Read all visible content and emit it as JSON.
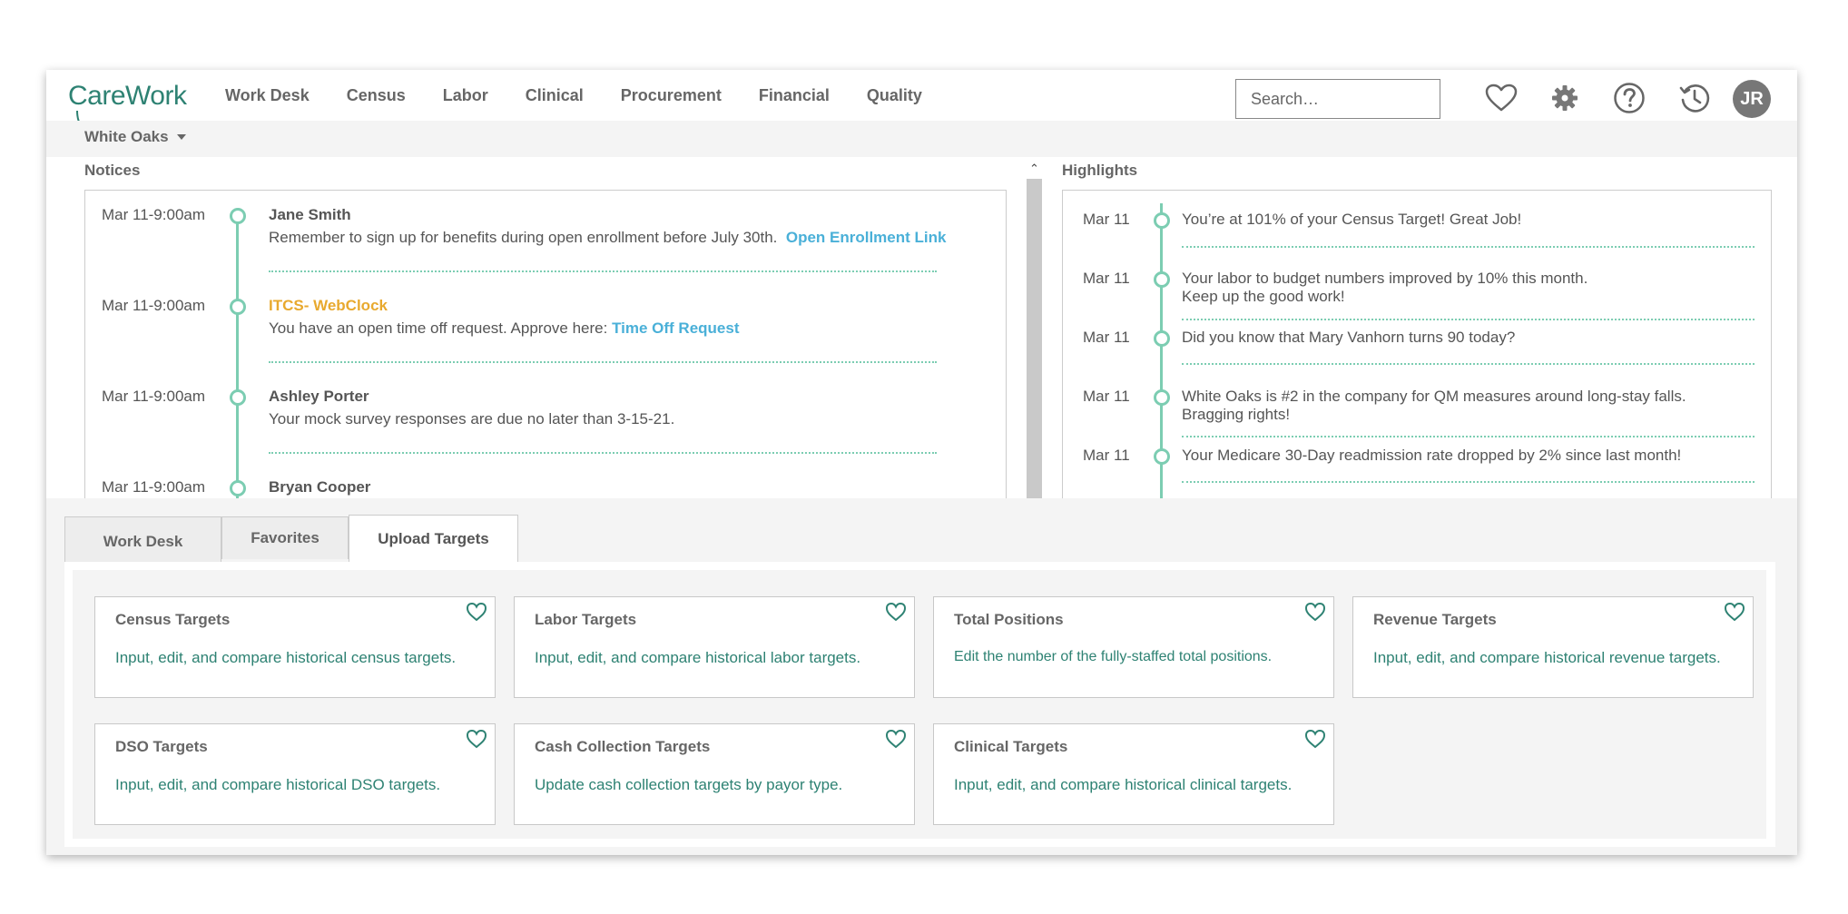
{
  "app": {
    "logo": "CareWork"
  },
  "nav": {
    "items": [
      "Work Desk",
      "Census",
      "Labor",
      "Clinical",
      "Procurement",
      "Financial",
      "Quality"
    ],
    "search_placeholder": "Search…",
    "avatar_initials": "JR"
  },
  "icons": {
    "favorites": "heart-icon",
    "settings": "gear-icon",
    "help": "help-icon",
    "history": "history-icon",
    "dropdown": "caret-down-icon",
    "scroll_up": "chevron-up-icon"
  },
  "facility": {
    "name": "White Oaks"
  },
  "notices": {
    "title": "Notices",
    "items": [
      {
        "date": "Mar 11-9:00am",
        "author": "Jane Smith",
        "body": "Remember to sign up for benefits during open enrollment before July 30th.",
        "link": "Open Enrollment Link",
        "highlight": false
      },
      {
        "date": "Mar 11-9:00am",
        "author": "ITCS- WebClock",
        "body": "You have an open time off request.  Approve here:",
        "link": "Time Off Request",
        "highlight": true
      },
      {
        "date": "Mar 11-9:00am",
        "author": "Ashley Porter",
        "body": "Your mock survey responses are due no later than 3-15-21.",
        "link": "",
        "highlight": false
      },
      {
        "date": "Mar 11-9:00am",
        "author": "Bryan Cooper",
        "body": "",
        "link": "",
        "highlight": false
      }
    ]
  },
  "highlights": {
    "title": "Highlights",
    "items": [
      {
        "date": "Mar 11",
        "text": "You’re at 101% of your Census Target!  Great Job!"
      },
      {
        "date": "Mar 11",
        "text": "Your labor to budget numbers improved by 10% this month.\nKeep up the good work!"
      },
      {
        "date": "Mar 11",
        "text": "Did you know that Mary Vanhorn turns 90 today?"
      },
      {
        "date": "Mar 11",
        "text": "White Oaks is #2 in the company for QM measures around long-stay falls.\nBragging rights!"
      },
      {
        "date": "Mar 11",
        "text": "Your Medicare 30-Day readmission rate dropped by 2% since last month!"
      }
    ]
  },
  "tabs": [
    {
      "label": "Work Desk",
      "active": false
    },
    {
      "label": "Favorites",
      "active": false
    },
    {
      "label": "Upload Targets",
      "active": true
    }
  ],
  "cards": [
    {
      "title": "Census Targets",
      "desc": "Input, edit, and compare historical census targets."
    },
    {
      "title": "Labor Targets",
      "desc": "Input, edit, and compare historical labor targets."
    },
    {
      "title": "Total Positions",
      "desc": "Edit the number of the fully-staffed total positions."
    },
    {
      "title": "Revenue Targets",
      "desc": "Input, edit, and compare historical revenue targets."
    },
    {
      "title": "DSO Targets",
      "desc": "Input, edit, and compare historical DSO targets."
    },
    {
      "title": "Cash Collection Targets",
      "desc": "Update cash collection targets by payor type."
    },
    {
      "title": "Clinical Targets",
      "desc": "Input, edit, and compare historical clinical targets."
    }
  ],
  "colors": {
    "accent": "#2e8273",
    "timeline": "#7ccdb2",
    "link": "#4ab0d8",
    "highlight_author": "#e8a92e",
    "panel_bg": "#f4f4f4"
  }
}
